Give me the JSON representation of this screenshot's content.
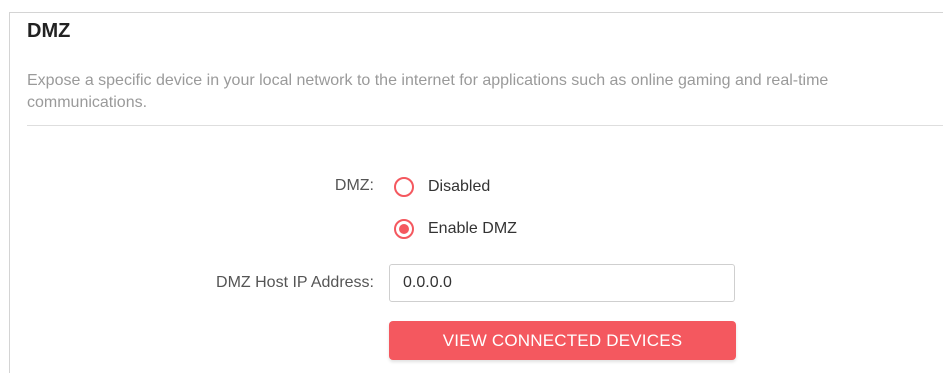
{
  "section": {
    "title": "DMZ",
    "description": "Expose a specific device in your local network to the internet for applications such as online gaming and real-time communications."
  },
  "dmz": {
    "label": "DMZ:",
    "options": [
      {
        "label": "Disabled",
        "selected": false
      },
      {
        "label": "Enable DMZ",
        "selected": true
      }
    ]
  },
  "host_ip": {
    "label": "DMZ Host IP Address:",
    "value": "0.0.0.0"
  },
  "actions": {
    "view_devices_label": "VIEW CONNECTED DEVICES"
  },
  "colors": {
    "accent": "#f4585f",
    "title_text": "#222222",
    "description_text": "#9a9a9a"
  },
  "icons": {
    "radio_unchecked": "radio-unchecked-icon",
    "radio_checked": "radio-checked-icon"
  }
}
